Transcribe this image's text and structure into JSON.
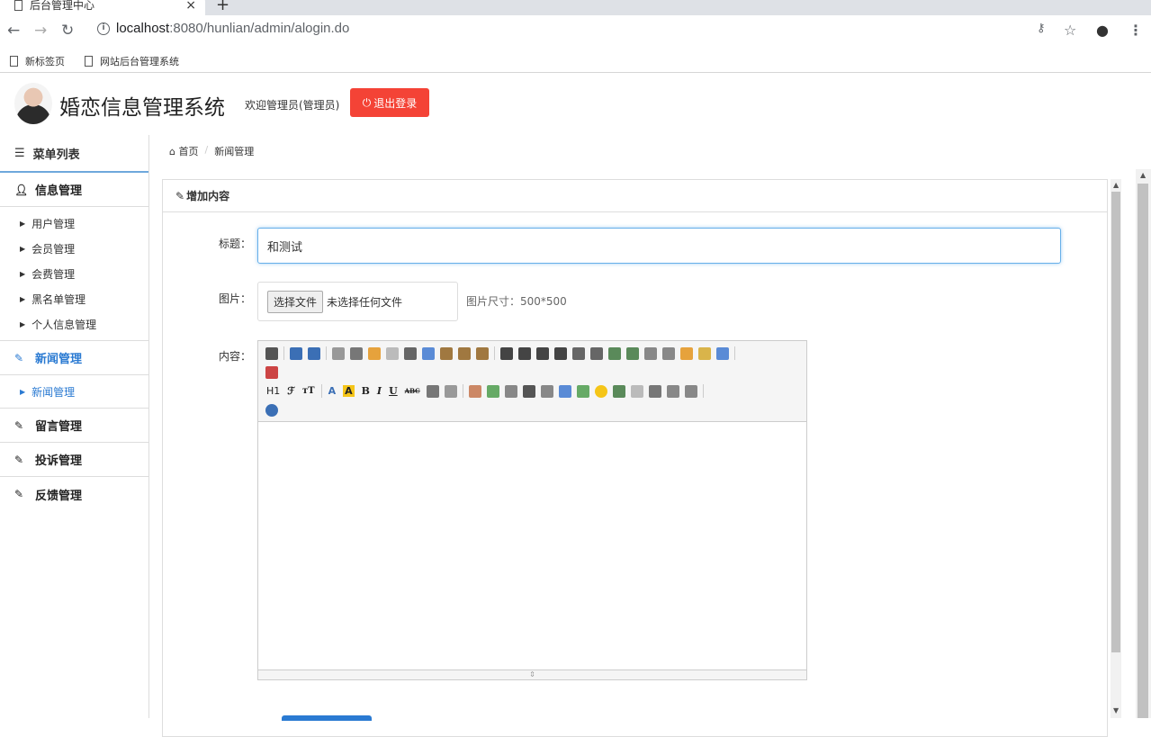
{
  "browser": {
    "tab_title": "后台管理中心",
    "tab_close": "×",
    "new_tab": "+",
    "url_host": "localhost",
    "url_path": ":8080/hunlian/admin/alogin.do",
    "bookmarks": [
      "新标签页",
      "网站后台管理系统"
    ]
  },
  "header": {
    "system_title": "婚恋信息管理系统",
    "welcome": "欢迎管理员(管理员)",
    "logout_label": "退出登录"
  },
  "sidebar": {
    "heading": "菜单列表",
    "sections": [
      {
        "label": "信息管理",
        "icon": "user-icon"
      },
      {
        "label": "新闻管理",
        "icon": "edit-icon"
      },
      {
        "label": "留言管理",
        "icon": "edit-icon"
      },
      {
        "label": "投诉管理",
        "icon": "edit-icon"
      },
      {
        "label": "反馈管理",
        "icon": "edit-icon"
      }
    ],
    "info_items": [
      "用户管理",
      "会员管理",
      "会费管理",
      "黑名单管理",
      "个人信息管理"
    ],
    "news_items": [
      "新闻管理"
    ]
  },
  "breadcrumb": {
    "home": "首页",
    "current": "新闻管理"
  },
  "form": {
    "panel_title": "增加内容",
    "title_label": "标题：",
    "title_value": "和测试",
    "image_label": "图片：",
    "file_button": "选择文件",
    "file_status": "未选择任何文件",
    "image_hint": "图片尺寸：500*500",
    "content_label": "内容："
  },
  "editor": {
    "heading_btn": "H1",
    "font_btn": "ℱ",
    "size_btn": "тT",
    "fontcolor_btn": "A",
    "bgcolor_btn": "A",
    "bold": "B",
    "italic": "I",
    "underline": "U",
    "strike": "ABC"
  },
  "colors": {
    "accent": "#2a7ad2",
    "danger": "#f44336"
  }
}
